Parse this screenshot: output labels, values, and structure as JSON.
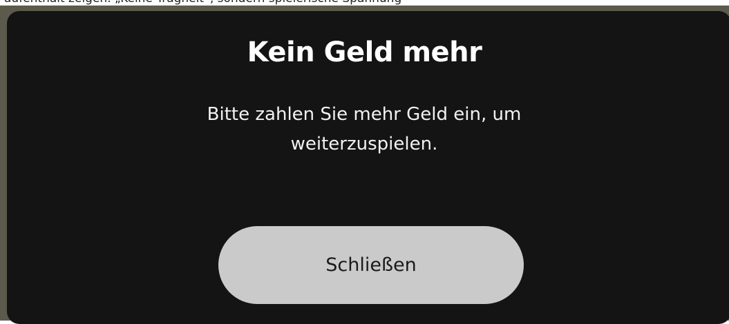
{
  "page": {
    "top_text": "aufenthalt zeigen. „Keine Trägheit“, sondern spielerische Spannung"
  },
  "dialog": {
    "title": "Kein Geld mehr",
    "message": "Bitte zahlen Sie mehr Geld ein, um weiterzuspielen.",
    "close_button_label": "Schließen"
  },
  "colors": {
    "backdrop": "#5c5a4c",
    "dialog_background": "#141414",
    "title_text": "#ffffff",
    "message_text": "#f2f2f2",
    "button_background": "#cacaca",
    "button_text": "#1a1a1a"
  }
}
